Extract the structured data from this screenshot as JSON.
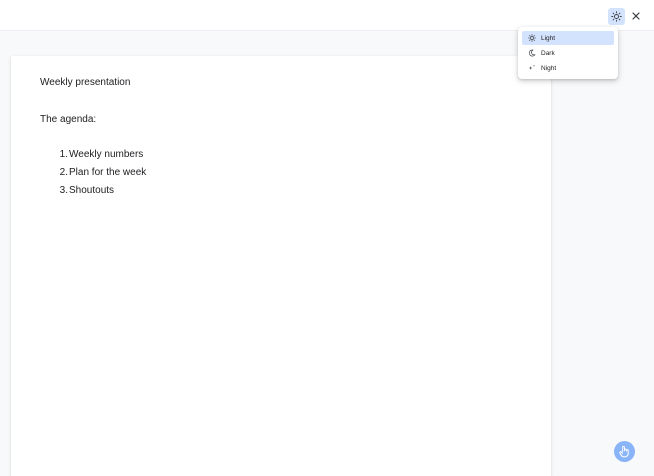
{
  "toolbar": {
    "theme_icon": "sun-icon",
    "close_icon": "close-icon"
  },
  "document": {
    "title": "Weekly presentation",
    "paragraph": "The agenda:",
    "list": [
      {
        "number": "1.",
        "text": "Weekly numbers"
      },
      {
        "number": "2.",
        "text": "Plan for the week"
      },
      {
        "number": "3.",
        "text": "Shoutouts"
      }
    ]
  },
  "theme_menu": {
    "items": [
      {
        "label": "Light",
        "icon": "sun-icon",
        "selected": true
      },
      {
        "label": "Dark",
        "icon": "moon-icon",
        "selected": false
      },
      {
        "label": "Night",
        "icon": "sparkle-icon",
        "selected": false
      }
    ]
  },
  "fab": {
    "icon": "hand-pointer-icon"
  },
  "colors": {
    "accent": "#d3e3fd",
    "fab": "#8ab4f8",
    "background": "#f8f9fa"
  }
}
